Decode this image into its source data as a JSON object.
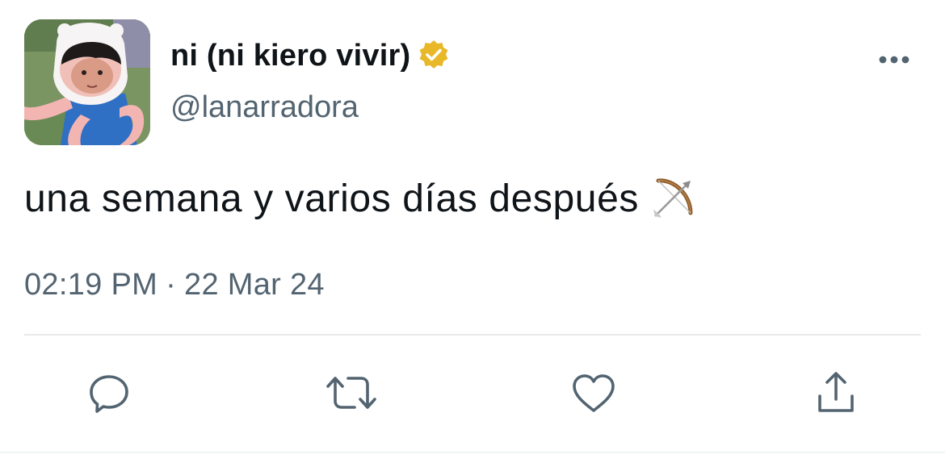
{
  "user": {
    "display_name": "ni (ni kiero vivir)",
    "handle": "@lanarradora",
    "verified": true,
    "verified_color": "#e8b829"
  },
  "tweet": {
    "text": "una semana y varios días después",
    "emoji": "bow-and-arrow",
    "time": "02:19 PM",
    "separator": "·",
    "date": "22 Mar 24"
  },
  "actions": [
    {
      "name": "reply",
      "icon": "reply-icon"
    },
    {
      "name": "retweet",
      "icon": "retweet-icon"
    },
    {
      "name": "like",
      "icon": "heart-icon"
    },
    {
      "name": "share",
      "icon": "share-icon"
    }
  ],
  "colors": {
    "text_primary": "#0f1419",
    "text_secondary": "#536471",
    "icon": "#536471",
    "divider": "#e7e9ea"
  }
}
